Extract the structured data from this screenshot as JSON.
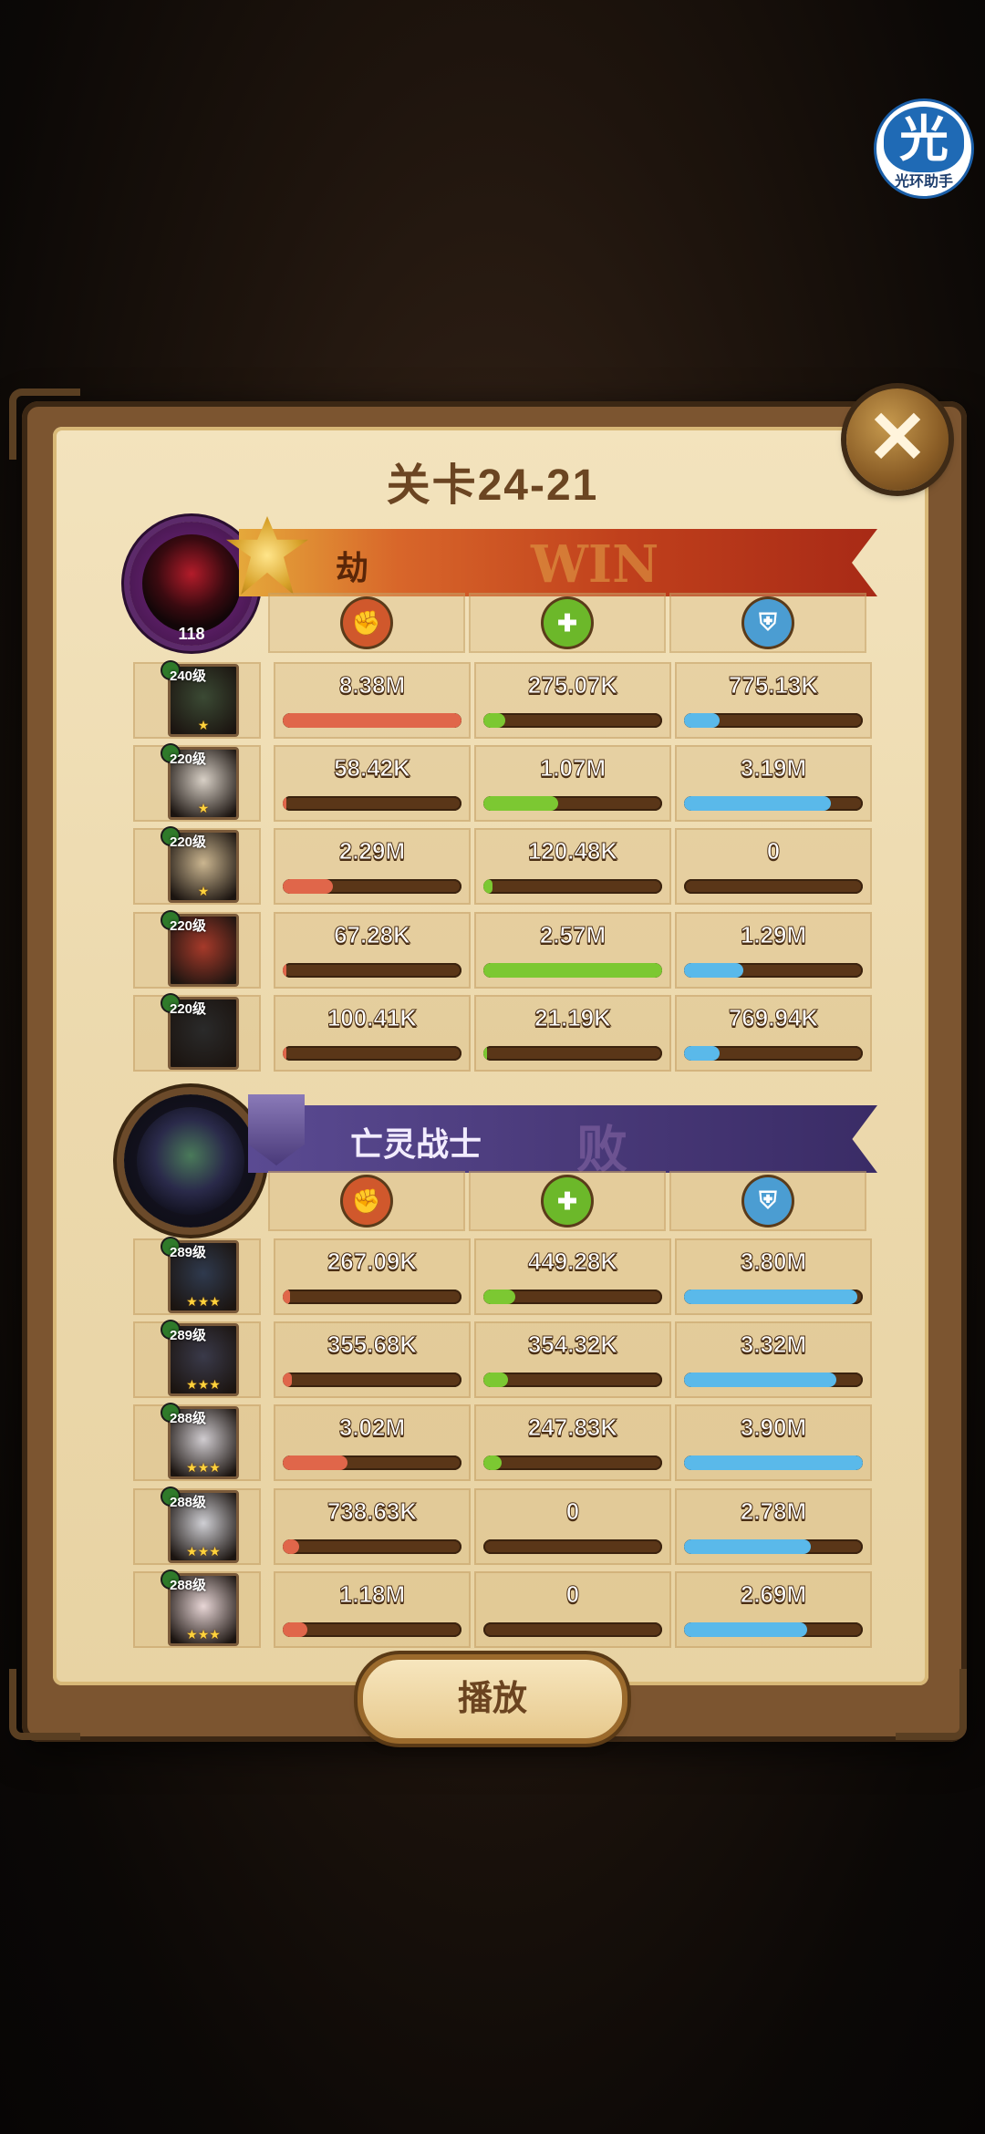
{
  "watermark": {
    "glyph": "光",
    "label": "光环助手"
  },
  "dialog": {
    "title": "关卡24-21",
    "close_icon": "close-icon",
    "play_label": "播放"
  },
  "teams": [
    {
      "name": "劫",
      "result": "WIN",
      "level": "118",
      "banner_color": "#c9431a",
      "stat_icons": [
        "damage-icon",
        "heal-icon",
        "shield-icon"
      ],
      "heroes": [
        {
          "level": "240级",
          "stars": "★",
          "damage": "8.38M",
          "heal": "275.07K",
          "shield": "775.13K",
          "damage_pct": 100,
          "heal_pct": 12,
          "shield_pct": 20
        },
        {
          "level": "220级",
          "stars": "★",
          "damage": "58.42K",
          "heal": "1.07M",
          "shield": "3.19M",
          "damage_pct": 1,
          "heal_pct": 42,
          "shield_pct": 82
        },
        {
          "level": "220级",
          "stars": "★",
          "damage": "2.29M",
          "heal": "120.48K",
          "shield": "0",
          "damage_pct": 28,
          "heal_pct": 5,
          "shield_pct": 0
        },
        {
          "level": "220级",
          "stars": "",
          "damage": "67.28K",
          "heal": "2.57M",
          "shield": "1.29M",
          "damage_pct": 1,
          "heal_pct": 100,
          "shield_pct": 33
        },
        {
          "level": "220级",
          "stars": "",
          "damage": "100.41K",
          "heal": "21.19K",
          "shield": "769.94K",
          "damage_pct": 2,
          "heal_pct": 1,
          "shield_pct": 20
        }
      ]
    },
    {
      "name": "亡灵战士",
      "result": "败",
      "level": "",
      "banner_color": "#4a3a7a",
      "stat_icons": [
        "damage-icon",
        "heal-icon",
        "shield-icon"
      ],
      "heroes": [
        {
          "level": "289级",
          "stars": "★★★",
          "damage": "267.09K",
          "heal": "449.28K",
          "shield": "3.80M",
          "damage_pct": 4,
          "heal_pct": 18,
          "shield_pct": 97
        },
        {
          "level": "289级",
          "stars": "★★★",
          "damage": "355.68K",
          "heal": "354.32K",
          "shield": "3.32M",
          "damage_pct": 5,
          "heal_pct": 14,
          "shield_pct": 85
        },
        {
          "level": "288级",
          "stars": "★★★",
          "damage": "3.02M",
          "heal": "247.83K",
          "shield": "3.90M",
          "damage_pct": 36,
          "heal_pct": 10,
          "shield_pct": 100
        },
        {
          "level": "288级",
          "stars": "★★★",
          "damage": "738.63K",
          "heal": "0",
          "shield": "2.78M",
          "damage_pct": 9,
          "heal_pct": 0,
          "shield_pct": 71
        },
        {
          "level": "288级",
          "stars": "★★★",
          "damage": "1.18M",
          "heal": "0",
          "shield": "2.69M",
          "damage_pct": 14,
          "heal_pct": 0,
          "shield_pct": 69
        }
      ]
    }
  ],
  "colors": {
    "damage": "#e0664a",
    "heal": "#7cc832",
    "shield": "#5ab9ea"
  }
}
